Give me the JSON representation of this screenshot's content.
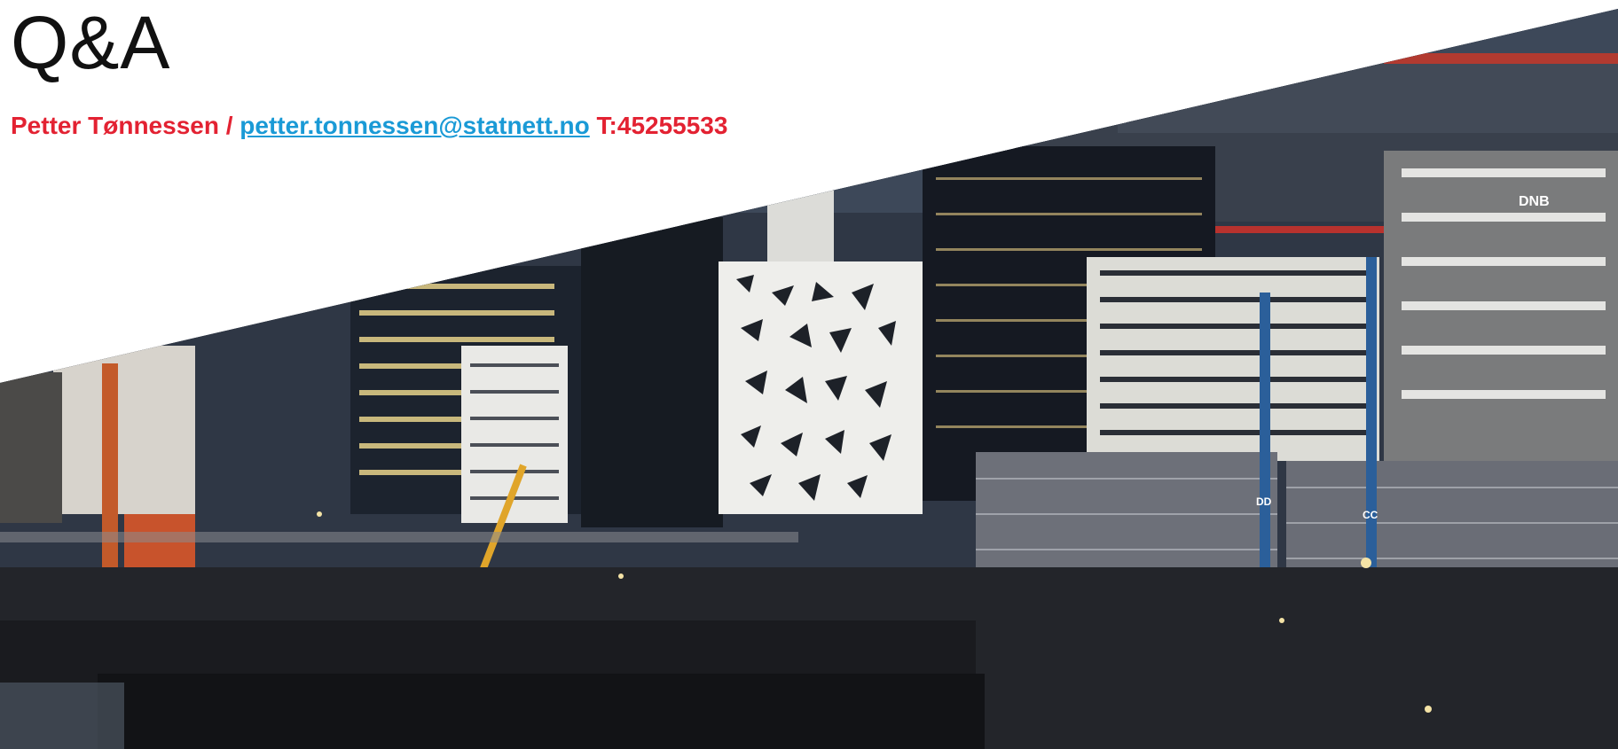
{
  "slide": {
    "title": "Q&A",
    "contact": {
      "name": "Petter Tønnessen",
      "separator": " / ",
      "email": "petter.tonnessen@statnett.no",
      "phone": "T:45255533"
    },
    "photo": {
      "building_sign_1": "DNB",
      "crane_mark_1": "DD",
      "crane_mark_2": "CC"
    }
  },
  "colors": {
    "accent_red": "#e32232",
    "link_blue": "#1a9ad6",
    "title_text": "#111111"
  }
}
